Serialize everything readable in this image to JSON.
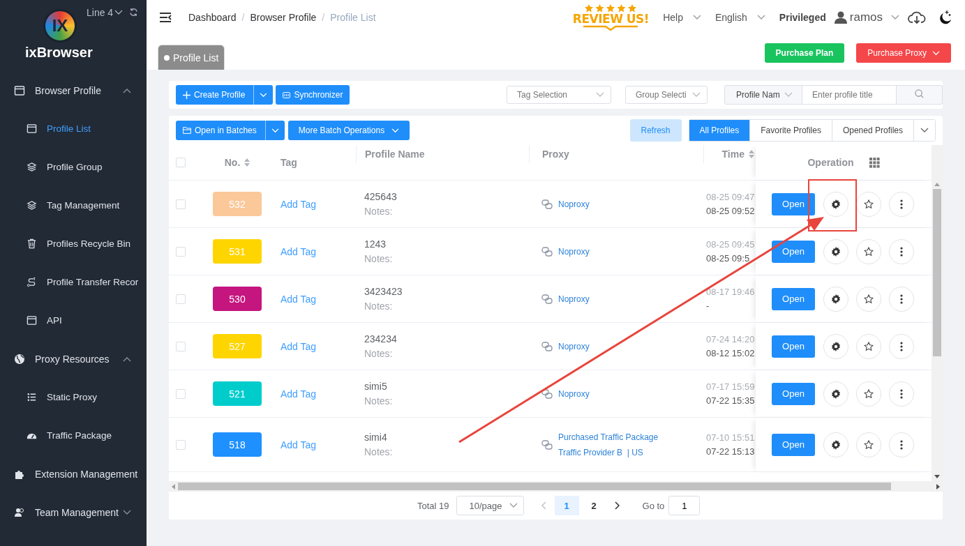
{
  "sidebar": {
    "logo_mark": "IX",
    "brand": "ixBrowser",
    "line": "Line 4",
    "items": [
      {
        "label": "Browser Profile",
        "expanded": true,
        "children": [
          {
            "label": "Profile List",
            "selected": true
          },
          {
            "label": "Profile Group",
            "selected": false
          },
          {
            "label": "Tag Management",
            "selected": false
          },
          {
            "label": "Profiles Recycle Bin",
            "selected": false
          },
          {
            "label": "Profile Transfer Recor",
            "selected": false
          },
          {
            "label": "API",
            "selected": false
          }
        ]
      },
      {
        "label": "Proxy Resources",
        "expanded": true,
        "children": [
          {
            "label": "Static Proxy",
            "selected": false
          },
          {
            "label": "Traffic Package",
            "selected": false
          }
        ]
      },
      {
        "label": "Extension Management"
      },
      {
        "label": "Team Management",
        "expanded": false
      }
    ]
  },
  "header": {
    "breadcrumb_separator": "/",
    "breadcrumb": [
      "Dashboard",
      "Browser Profile",
      "Profile List"
    ],
    "review_badge": "REVIEW US!",
    "help": "Help",
    "language": "English",
    "plan": "Privileged",
    "user": "ramos"
  },
  "page_tabs": [
    {
      "label": "Profile List",
      "selected": true
    }
  ],
  "purchase_buttons": [
    {
      "label": "Purchase Plan",
      "kind": "plan"
    },
    {
      "label": "Purchase Proxy",
      "kind": "proxy"
    }
  ],
  "toolbar": {
    "create": "Create Profile",
    "sync": "Synchronizer",
    "tag_filter": {
      "placeholder": "Tag Selection"
    },
    "group_filter": {
      "placeholder": "Group Selecti"
    },
    "search_by": "Profile Nam",
    "search": {
      "placeholder": "Enter profile title"
    }
  },
  "batch_bar": {
    "open_batches": "Open in Batches",
    "more": "More Batch Operations",
    "refresh": "Refresh",
    "filters": [
      {
        "label": "All Profiles",
        "selected": true
      },
      {
        "label": "Favorite Profiles",
        "selected": false
      },
      {
        "label": "Opened Profiles",
        "selected": false
      }
    ]
  },
  "table": {
    "select_all_checked": false,
    "columns": [
      "No.",
      "Tag",
      "Profile Name",
      "Proxy",
      "Time",
      "Operation"
    ],
    "rows": [
      {
        "checked": false,
        "no": "532",
        "color": "#fbc899",
        "tag": "Add Tag",
        "name": "425643",
        "notes": "Notes:",
        "proxy": [
          "Noproxy"
        ],
        "time": [
          "08-25 09:47",
          "08-25 09:52"
        ],
        "open": "Open"
      },
      {
        "checked": false,
        "no": "531",
        "color": "#ffd500",
        "tag": "Add Tag",
        "name": "1243",
        "notes": "Notes:",
        "proxy": [
          "Noproxy"
        ],
        "time": [
          "08-25 09:45",
          "08-25 09:5"
        ],
        "open": "Open"
      },
      {
        "checked": false,
        "no": "530",
        "color": "#c5157f",
        "tag": "Add Tag",
        "name": "3423423",
        "notes": "Notes:",
        "proxy": [
          "Noproxy"
        ],
        "time": [
          "08-17 19:46",
          "-"
        ],
        "open": "Open"
      },
      {
        "checked": false,
        "no": "527",
        "color": "#ffd500",
        "tag": "Add Tag",
        "name": "234234",
        "notes": "Notes:",
        "proxy": [
          "Noproxy"
        ],
        "time": [
          "07-24 14:20",
          "08-12 15:02"
        ],
        "open": "Open"
      },
      {
        "checked": false,
        "no": "521",
        "color": "#00cccc",
        "tag": "Add Tag",
        "name": "simi5",
        "notes": "Notes:",
        "proxy": [
          "Noproxy"
        ],
        "time": [
          "07-17 15:59",
          "07-22 15:35"
        ],
        "open": "Open"
      },
      {
        "checked": false,
        "no": "518",
        "color": "#1e90ff",
        "tag": "Add Tag",
        "name": "simi4",
        "notes": "Notes:",
        "proxy": [
          "Purchased Traffic Package",
          "Traffic Provider B  | US"
        ],
        "time": [
          "07-10 15:51",
          "07-22 15:13"
        ],
        "open": "Open"
      }
    ]
  },
  "pagination": {
    "total": "Total 19",
    "page_size": "10/page",
    "pages": [
      {
        "label": "1",
        "selected": true
      },
      {
        "label": "2",
        "selected": false
      }
    ],
    "goto_label": "Go to",
    "goto_value": "1"
  }
}
